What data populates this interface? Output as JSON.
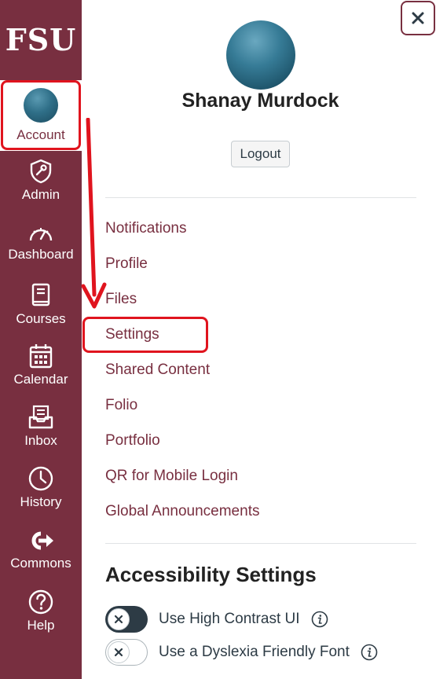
{
  "sidebar": {
    "logo_text": "FSU",
    "items": [
      {
        "label": "Account",
        "icon": "avatar"
      },
      {
        "label": "Admin",
        "icon": "shield-icon"
      },
      {
        "label": "Dashboard",
        "icon": "dashboard-icon"
      },
      {
        "label": "Courses",
        "icon": "book-icon"
      },
      {
        "label": "Calendar",
        "icon": "calendar-icon"
      },
      {
        "label": "Inbox",
        "icon": "inbox-icon"
      },
      {
        "label": "History",
        "icon": "clock-icon"
      },
      {
        "label": "Commons",
        "icon": "commons-icon"
      },
      {
        "label": "Help",
        "icon": "help-icon"
      }
    ]
  },
  "tray": {
    "close_icon": "close-icon",
    "user_name": "Shanay Murdock",
    "logout_label": "Logout",
    "links": [
      "Notifications",
      "Profile",
      "Files",
      "Settings",
      "Shared Content",
      "Folio",
      "Portfolio",
      "QR for Mobile Login",
      "Global Announcements"
    ],
    "accessibility_heading": "Accessibility Settings",
    "toggles": [
      {
        "label": "Use High Contrast UI",
        "state": "off",
        "style": "dark"
      },
      {
        "label": "Use a Dyslexia Friendly Font",
        "state": "off",
        "style": "light"
      }
    ]
  },
  "colors": {
    "brand": "#782F40",
    "highlight": "#e0141e",
    "text_dark": "#2d3b45"
  }
}
